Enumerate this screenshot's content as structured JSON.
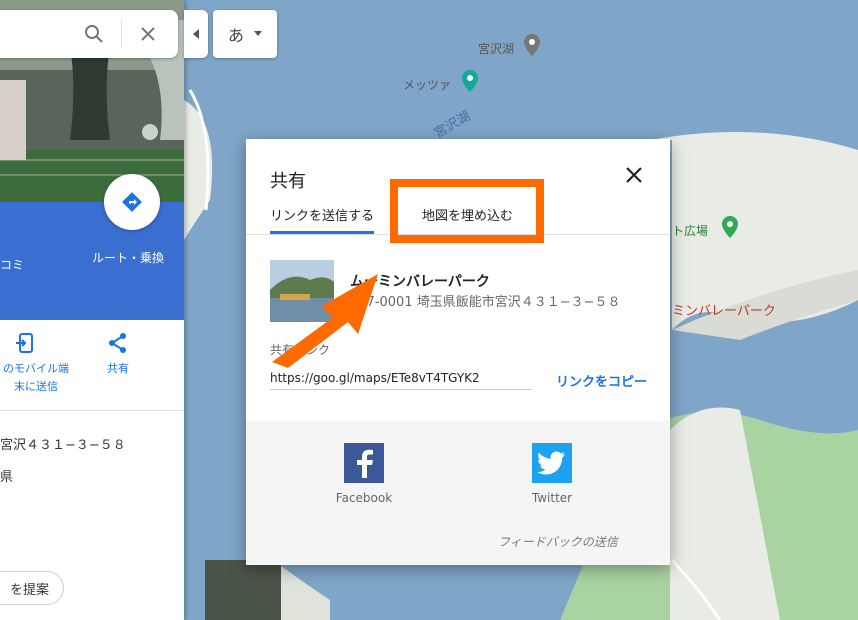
{
  "map": {
    "labels": {
      "lake": "宮沢湖",
      "messa": "メッツァ",
      "lake_water": "宮沢湖",
      "plaza": "ト広場",
      "park": "ミンバレーパーク"
    }
  },
  "ime": {
    "label": "あ"
  },
  "panel": {
    "band": {
      "left_text": "コミ",
      "route_label": "ルート・乗換"
    },
    "actions": {
      "send_line1": "のモバイル端",
      "send_line2": "末に送信",
      "share_label": "共有"
    },
    "info": {
      "address_partial": "宮沢４３１−３−５８",
      "line2": "県"
    },
    "suggest_label": "を提案"
  },
  "dialog": {
    "title": "共有",
    "tabs": [
      {
        "label": "リンクを送信する",
        "active": true
      },
      {
        "label": "地図を埋め込む",
        "active": false
      }
    ],
    "place": {
      "name": "ムーミンバレーパーク",
      "address": "357-0001 埼玉県飯能市宮沢４３１−３−５８"
    },
    "link_label": "共有リンク",
    "link_value": "https://goo.gl/maps/ETe8vT4TGYK2",
    "copy_label": "リンクをコピー",
    "social": [
      {
        "name": "Facebook",
        "icon": "facebook-icon",
        "color": "#3b5998"
      },
      {
        "name": "Twitter",
        "icon": "twitter-icon",
        "color": "#1da1f2"
      }
    ],
    "feedback": "フィードバックの送信"
  },
  "colors": {
    "accent": "#1a73e8",
    "highlight": "#ff6a00",
    "panel_blue": "#3b6ed1"
  }
}
